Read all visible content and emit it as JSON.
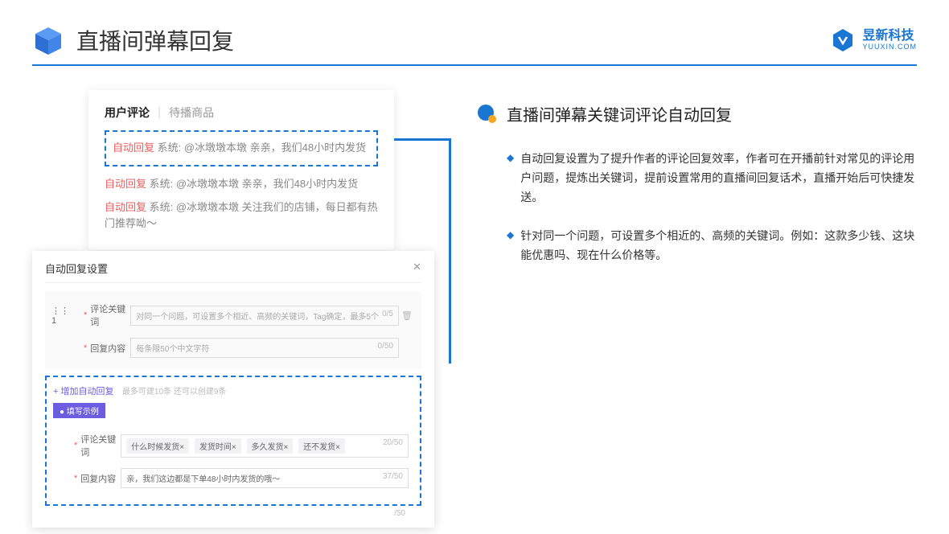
{
  "header": {
    "title": "直播间弹幕回复",
    "brand": "昱新科技",
    "brand_sub": "YUUXIN.COM"
  },
  "card1": {
    "tab_active": "用户评论",
    "tab_other": "待播商品",
    "highlight_tag": "自动回复",
    "highlight_text": "系统: @冰墩墩本墩 亲亲，我们48小时内发货",
    "row2_tag": "自动回复",
    "row2_text": "系统: @冰墩墩本墩 亲亲，我们48小时内发货",
    "row3_tag": "自动回复",
    "row3_text": "系统: @冰墩墩本墩 关注我们的店铺，每日都有热门推荐呦～"
  },
  "card2": {
    "title": "自动回复设置",
    "row_num": "1",
    "label_keyword": "评论关键词",
    "placeholder_keyword": "对同一个问题，可设置多个相近、高频的关键词，Tag确定，最多5个",
    "count_keyword": "0/5",
    "label_content": "回复内容",
    "placeholder_content": "每条限50个中文字符",
    "count_content": "0/50",
    "add_link": "+ 增加自动回复",
    "add_hint": "最多可建10条 还可以创建9条",
    "example_badge": "● 填写示例",
    "ex_label_kw": "评论关键词",
    "ex_tag1": "什么时候发货×",
    "ex_tag2": "发货时间×",
    "ex_tag3": "多久发货×",
    "ex_tag4": "还不发货×",
    "ex_count_kw": "20/50",
    "ex_label_ct": "回复内容",
    "ex_content": "亲，我们这边都是下单48小时内发货的哦～",
    "ex_count_ct": "37/50",
    "outer_count": "/50"
  },
  "right": {
    "title": "直播间弹幕关键词评论自动回复",
    "bullet1": "自动回复设置为了提升作者的评论回复效率，作者可在开播前针对常见的评论用户问题，提炼出关键词，提前设置常用的直播间回复话术，直播开始后可快捷发送。",
    "bullet2": "针对同一个问题，可设置多个相近的、高频的关键词。例如：这款多少钱、这块能优惠吗、现在什么价格等。"
  }
}
